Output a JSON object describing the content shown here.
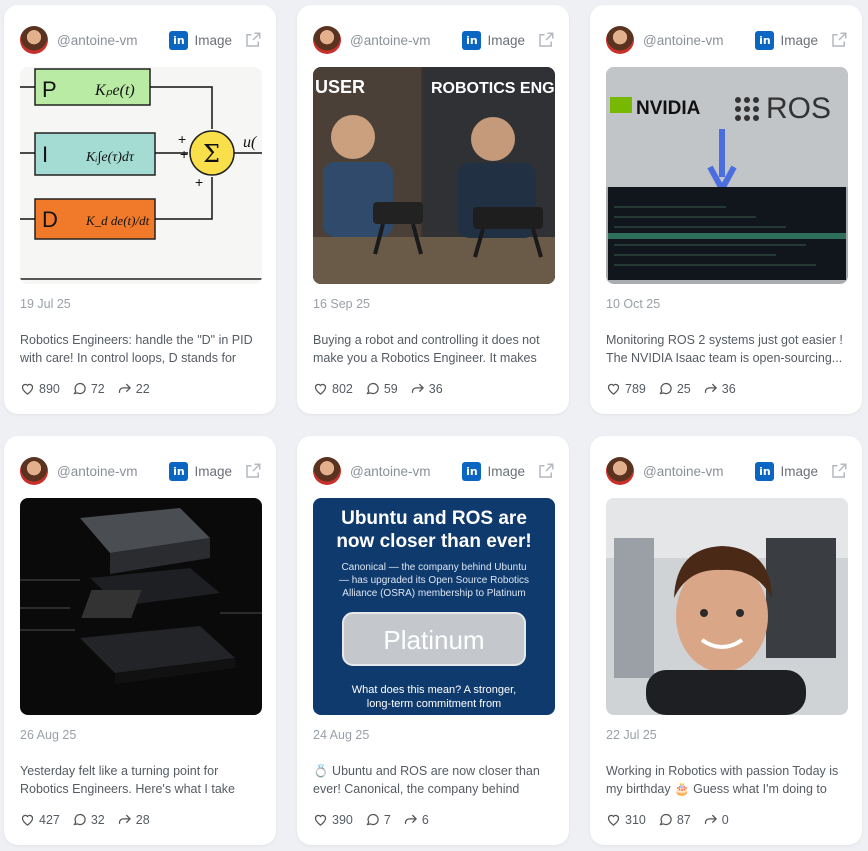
{
  "posts": [
    {
      "author": "@antoine-vm",
      "type": "Image",
      "date": "19 Jul 25",
      "text": "Robotics Engineers: handle the \"D\" in PID with care! In control loops, D stands for derivative...",
      "likes": "890",
      "comments": "72",
      "shares": "22"
    },
    {
      "author": "@antoine-vm",
      "type": "Image",
      "date": "16 Sep 25",
      "text": "Buying a robot and controlling it does not make you a Robotics Engineer. It makes you a user...",
      "likes": "802",
      "comments": "59",
      "shares": "36",
      "labels": [
        "USER",
        "ROBOTICS ENGIN"
      ]
    },
    {
      "author": "@antoine-vm",
      "type": "Image",
      "date": "10 Oct 25",
      "text": "Monitoring ROS 2 systems just got easier ! The NVIDIA Isaac team is open-sourcing...",
      "likes": "789",
      "comments": "25",
      "shares": "36",
      "labels": [
        "NVIDIA",
        "ROS"
      ]
    },
    {
      "author": "@antoine-vm",
      "type": "Image",
      "date": "26 Aug 25",
      "text": "Yesterday felt like a turning point for Robotics Engineers. Here's what I take away...",
      "likes": "427",
      "comments": "32",
      "shares": "28"
    },
    {
      "author": "@antoine-vm",
      "type": "Image",
      "date": "24 Aug 25",
      "text": "💍 Ubuntu and ROS are now closer than ever! Canonical, the company behind Ubuntu...",
      "likes": "390",
      "comments": "7",
      "shares": "6",
      "labels": [
        "Ubuntu and ROS are",
        "now closer than ever!",
        "Canonical — the company behind Ubuntu",
        "— has upgraded its Open Source Robotics",
        "Alliance (OSRA) membership to Platinum",
        "Platinum",
        "What does this mean? A stronger,",
        "long-term commitment from"
      ]
    },
    {
      "author": "@antoine-vm",
      "type": "Image",
      "date": "22 Jul 25",
      "text": "Working in Robotics with passion Today is my birthday 🎂 Guess what I'm doing to celebrate...",
      "likes": "310",
      "comments": "87",
      "shares": "0"
    }
  ],
  "pid": {
    "p": "P",
    "i": "I",
    "d": "D",
    "kp": "Kₚe(t)",
    "ki": "Kᵢ∫e(τ)dτ",
    "kd": "K_d de(t)/dt",
    "sum": "Σ",
    "plus": "+",
    "u": "u("
  },
  "colors": {
    "linkedin": "#0a66c2",
    "bg": "#eef0f4",
    "ubuntu_bg": "#0f3a6e"
  }
}
